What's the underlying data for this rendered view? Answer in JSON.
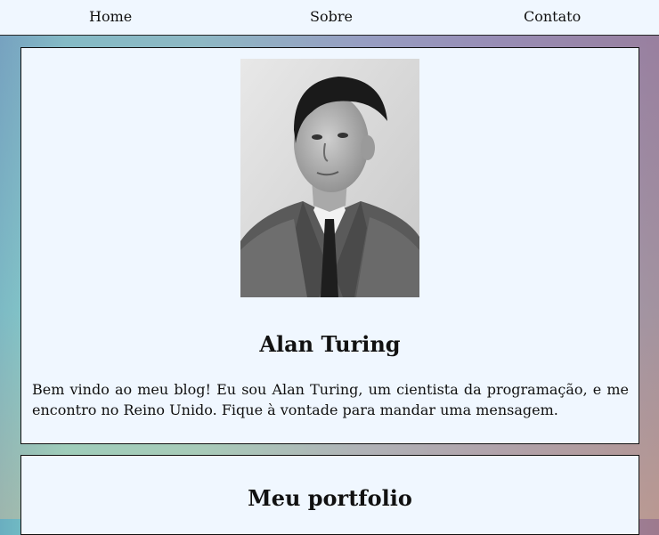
{
  "nav": {
    "items": [
      {
        "label": "Home"
      },
      {
        "label": "Sobre"
      },
      {
        "label": "Contato"
      }
    ]
  },
  "profile": {
    "photo_subject": "portrait-photo",
    "name": "Alan Turing",
    "bio": "Bem vindo ao meu blog! Eu sou Alan Turing, um cientista da programação, e me encontro no Reino Unido. Fique à vontade para mandar uma mensagem."
  },
  "portfolio": {
    "title": "Meu portfolio"
  },
  "colors": {
    "card_bg": "#f0f7ff",
    "border": "#111111",
    "text": "#111111"
  }
}
